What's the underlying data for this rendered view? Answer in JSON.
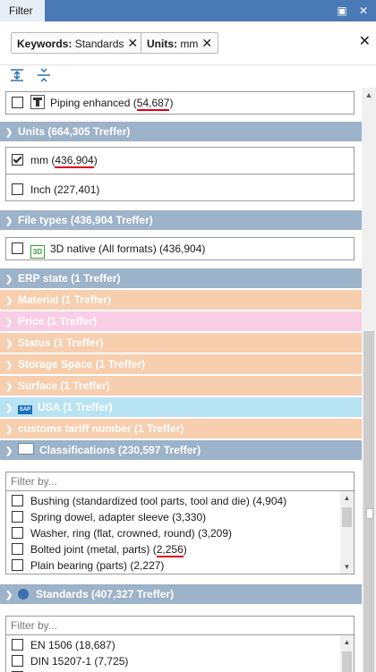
{
  "panel": {
    "title": "Filter",
    "pin_glyph": "▣",
    "close_glyph": "✕"
  },
  "chips": [
    {
      "key": "Keywords:",
      "value": " Standards",
      "remove": "✕"
    },
    {
      "key": "Units:",
      "value": " mm",
      "remove": "✕"
    }
  ],
  "clear_all": "✕",
  "top_item": {
    "label": "Piping enhanced",
    "count_prefix": " (",
    "count": "54,687",
    "count_suffix": ")"
  },
  "units": {
    "header": "Units (664,305 Treffer)",
    "items": [
      {
        "label": "mm",
        "count_prefix": " (",
        "count": "436,904",
        "count_suffix": ")",
        "checked": true
      },
      {
        "label": "Inch (227,401)",
        "checked": false
      }
    ]
  },
  "file_types": {
    "header": "File types (436,904 Treffer)",
    "icon_text": "3D",
    "item": "3D native (All formats) (436,904)"
  },
  "collapsed": [
    {
      "label": "ERP state (1 Treffer)",
      "color": "#9cb3c9"
    },
    {
      "label": "Material (1 Treffer)",
      "color": "#f7ceae"
    },
    {
      "label": "Price (1 Treffer)",
      "color": "#f9cde3"
    },
    {
      "label": "Status (1 Treffer)",
      "color": "#f7ceae"
    },
    {
      "label": "Storage Space (1 Treffer)",
      "color": "#f7ceae"
    },
    {
      "label": "Surface (1 Treffer)",
      "color": "#f7ceae"
    },
    {
      "label": "USA (1 Treffer)",
      "color": "#b8e3f2"
    },
    {
      "label": "customs tariff number (1 Treffer)",
      "color": "#f7ceae"
    }
  ],
  "sap_badge": "SAP",
  "classifications": {
    "header": "Classifications (230,597 Treffer)",
    "filter_placeholder": "Filter by...",
    "items": [
      {
        "label": "Bushing (standardized tool parts, tool and die) (4,904)"
      },
      {
        "label": "Spring dowel, adapter sleeve (3,330)"
      },
      {
        "label": "Washer, ring (flat, crowned, round) (3,209)"
      },
      {
        "label": "Bolted joint (metal, parts) (",
        "count": "2,256",
        "suffix": ")"
      },
      {
        "label": "Plain bearing (parts) (2,227)"
      }
    ]
  },
  "standards": {
    "header": "Standards (407,327 Treffer)",
    "filter_placeholder": "Filter by...",
    "items": [
      {
        "label": "EN 1506 (18,687)"
      },
      {
        "label": "DIN 15207-1 (7,725)"
      }
    ]
  },
  "colors": {
    "header_blue": "#9cb3c9",
    "title_blue": "#4a7ab5",
    "underline_red": "#e0001b"
  }
}
